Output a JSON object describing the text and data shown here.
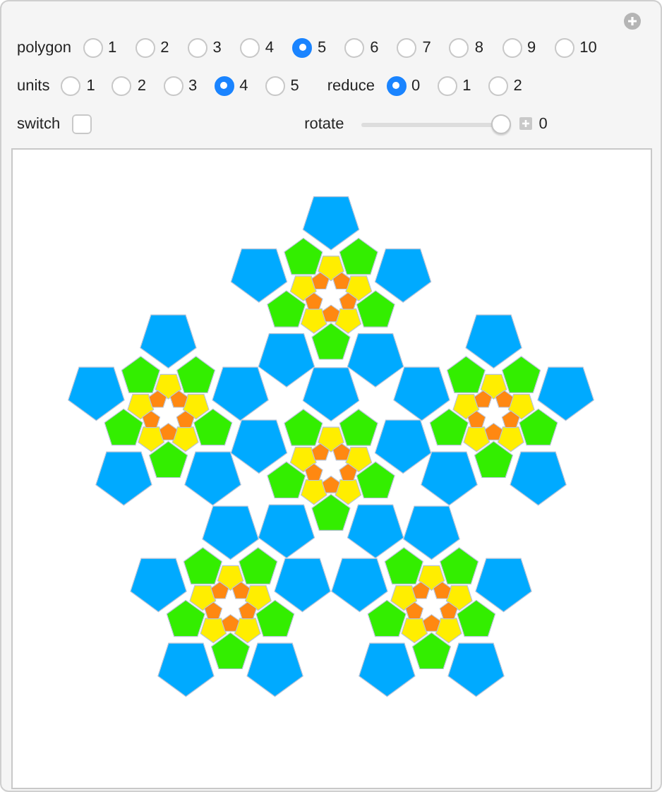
{
  "controls": {
    "polygon": {
      "label": "polygon",
      "options": [
        {
          "label": "1",
          "selected": false
        },
        {
          "label": "2",
          "selected": false
        },
        {
          "label": "3",
          "selected": false
        },
        {
          "label": "4",
          "selected": false
        },
        {
          "label": "5",
          "selected": true
        },
        {
          "label": "6",
          "selected": false
        },
        {
          "label": "7",
          "selected": false
        },
        {
          "label": "8",
          "selected": false
        },
        {
          "label": "9",
          "selected": false
        },
        {
          "label": "10",
          "selected": false
        }
      ]
    },
    "units": {
      "label": "units",
      "options": [
        {
          "label": "1",
          "selected": false
        },
        {
          "label": "2",
          "selected": false
        },
        {
          "label": "3",
          "selected": false
        },
        {
          "label": "4",
          "selected": true
        },
        {
          "label": "5",
          "selected": false
        }
      ]
    },
    "reduce": {
      "label": "reduce",
      "options": [
        {
          "label": "0",
          "selected": true
        },
        {
          "label": "1",
          "selected": false
        },
        {
          "label": "2",
          "selected": false
        }
      ]
    },
    "switch": {
      "label": "switch",
      "checked": false
    },
    "rotate": {
      "label": "rotate",
      "level": 1,
      "reading": "0"
    }
  }
}
